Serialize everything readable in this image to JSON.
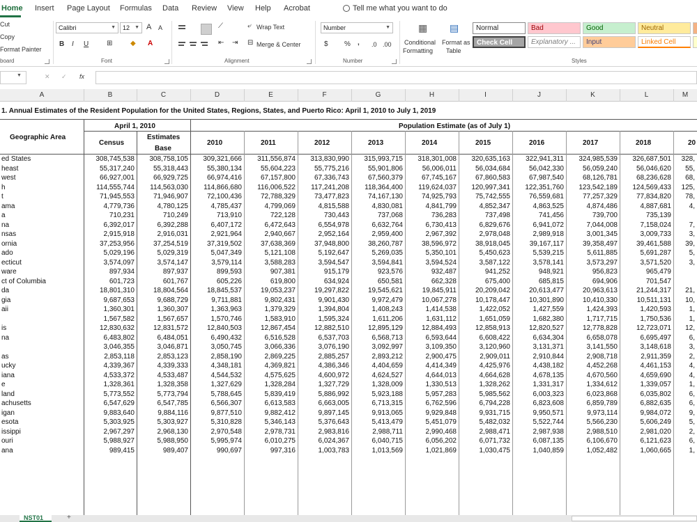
{
  "ribbon_tabs": [
    "Home",
    "Insert",
    "Page Layout",
    "Formulas",
    "Data",
    "Review",
    "View",
    "Help",
    "Acrobat"
  ],
  "tell_me": "Tell me what you want to do",
  "clipboard": {
    "cut": "Cut",
    "copy": "Copy",
    "format_painter": "Format Painter",
    "group": "board"
  },
  "font": {
    "name": "Calibri",
    "size": "12",
    "grow": "A",
    "shrink": "A",
    "bold": "B",
    "italic": "I",
    "underline": "U",
    "group": "Font"
  },
  "alignment": {
    "wrap": "Wrap Text",
    "merge": "Merge & Center",
    "group": "Alignment"
  },
  "number": {
    "format": "Number",
    "currency": "$",
    "percent": "%",
    "comma": ",",
    "inc": ".0",
    "dec": ".00",
    "group": "Number"
  },
  "styles": {
    "conditional": "Conditional",
    "conditional2": "Formatting",
    "format_as": "Format as",
    "format_as2": "Table",
    "cells": [
      "Normal",
      "Bad",
      "Good",
      "Neutral",
      "Check Cell",
      "Explanatory ...",
      "Input",
      "Linked Cell"
    ],
    "group": "Styles"
  },
  "formula_bar": {
    "cancel": "✕",
    "enter": "✓",
    "fx": "fx"
  },
  "columns": [
    "A",
    "B",
    "C",
    "D",
    "E",
    "F",
    "G",
    "H",
    "I",
    "J",
    "K",
    "L",
    "M"
  ],
  "title": "1. Annual Estimates of the Resident Population for the United States, Regions, States, and Puerto Rico: April 1, 2010 to July 1, 2019",
  "header": {
    "geo": "Geographic Area",
    "april": "April 1, 2010",
    "estimate": "Population Estimate (as of July 1)",
    "census": "Census",
    "base1": "Estimates",
    "base2": "Base",
    "years": [
      "2010",
      "2011",
      "2012",
      "2013",
      "2014",
      "2015",
      "2016",
      "2017",
      "2018",
      "20"
    ]
  },
  "rows": [
    {
      "name": "ed States",
      "v": [
        "308,745,538",
        "308,758,105",
        "309,321,666",
        "311,556,874",
        "313,830,990",
        "315,993,715",
        "318,301,008",
        "320,635,163",
        "322,941,311",
        "324,985,539",
        "326,687,501",
        "328,"
      ]
    },
    {
      "name": "heast",
      "v": [
        "55,317,240",
        "55,318,443",
        "55,380,134",
        "55,604,223",
        "55,775,216",
        "55,901,806",
        "56,006,011",
        "56,034,684",
        "56,042,330",
        "56,059,240",
        "56,046,620",
        "55,"
      ]
    },
    {
      "name": "west",
      "v": [
        "66,927,001",
        "66,929,725",
        "66,974,416",
        "67,157,800",
        "67,336,743",
        "67,560,379",
        "67,745,167",
        "67,860,583",
        "67,987,540",
        "68,126,781",
        "68,236,628",
        "68,"
      ]
    },
    {
      "name": "h",
      "v": [
        "114,555,744",
        "114,563,030",
        "114,866,680",
        "116,006,522",
        "117,241,208",
        "118,364,400",
        "119,624,037",
        "120,997,341",
        "122,351,760",
        "123,542,189",
        "124,569,433",
        "125,"
      ]
    },
    {
      "name": "t",
      "v": [
        "71,945,553",
        "71,946,907",
        "72,100,436",
        "72,788,329",
        "73,477,823",
        "74,167,130",
        "74,925,793",
        "75,742,555",
        "76,559,681",
        "77,257,329",
        "77,834,820",
        "78,"
      ]
    },
    {
      "name": "ama",
      "v": [
        "4,779,736",
        "4,780,125",
        "4,785,437",
        "4,799,069",
        "4,815,588",
        "4,830,081",
        "4,841,799",
        "4,852,347",
        "4,863,525",
        "4,874,486",
        "4,887,681",
        "4,"
      ]
    },
    {
      "name": "a",
      "v": [
        "710,231",
        "710,249",
        "713,910",
        "722,128",
        "730,443",
        "737,068",
        "736,283",
        "737,498",
        "741,456",
        "739,700",
        "735,139",
        ""
      ]
    },
    {
      "name": "na",
      "v": [
        "6,392,017",
        "6,392,288",
        "6,407,172",
        "6,472,643",
        "6,554,978",
        "6,632,764",
        "6,730,413",
        "6,829,676",
        "6,941,072",
        "7,044,008",
        "7,158,024",
        "7,"
      ]
    },
    {
      "name": "nsas",
      "v": [
        "2,915,918",
        "2,916,031",
        "2,921,964",
        "2,940,667",
        "2,952,164",
        "2,959,400",
        "2,967,392",
        "2,978,048",
        "2,989,918",
        "3,001,345",
        "3,009,733",
        "3,"
      ]
    },
    {
      "name": "ornia",
      "v": [
        "37,253,956",
        "37,254,519",
        "37,319,502",
        "37,638,369",
        "37,948,800",
        "38,260,787",
        "38,596,972",
        "38,918,045",
        "39,167,117",
        "39,358,497",
        "39,461,588",
        "39,"
      ]
    },
    {
      "name": "ado",
      "v": [
        "5,029,196",
        "5,029,319",
        "5,047,349",
        "5,121,108",
        "5,192,647",
        "5,269,035",
        "5,350,101",
        "5,450,623",
        "5,539,215",
        "5,611,885",
        "5,691,287",
        "5,"
      ]
    },
    {
      "name": "ecticut",
      "v": [
        "3,574,097",
        "3,574,147",
        "3,579,114",
        "3,588,283",
        "3,594,547",
        "3,594,841",
        "3,594,524",
        "3,587,122",
        "3,578,141",
        "3,573,297",
        "3,571,520",
        "3,"
      ]
    },
    {
      "name": "ware",
      "v": [
        "897,934",
        "897,937",
        "899,593",
        "907,381",
        "915,179",
        "923,576",
        "932,487",
        "941,252",
        "948,921",
        "956,823",
        "965,479",
        ""
      ]
    },
    {
      "name": "ct of Columbia",
      "v": [
        "601,723",
        "601,767",
        "605,226",
        "619,800",
        "634,924",
        "650,581",
        "662,328",
        "675,400",
        "685,815",
        "694,906",
        "701,547",
        ""
      ]
    },
    {
      "name": "da",
      "v": [
        "18,801,310",
        "18,804,564",
        "18,845,537",
        "19,053,237",
        "19,297,822",
        "19,545,621",
        "19,845,911",
        "20,209,042",
        "20,613,477",
        "20,963,613",
        "21,244,317",
        "21,"
      ]
    },
    {
      "name": "gia",
      "v": [
        "9,687,653",
        "9,688,729",
        "9,711,881",
        "9,802,431",
        "9,901,430",
        "9,972,479",
        "10,067,278",
        "10,178,447",
        "10,301,890",
        "10,410,330",
        "10,511,131",
        "10,"
      ]
    },
    {
      "name": "aii",
      "v": [
        "1,360,301",
        "1,360,307",
        "1,363,963",
        "1,379,329",
        "1,394,804",
        "1,408,243",
        "1,414,538",
        "1,422,052",
        "1,427,559",
        "1,424,393",
        "1,420,593",
        "1,"
      ]
    },
    {
      "name": "",
      "v": [
        "1,567,582",
        "1,567,657",
        "1,570,746",
        "1,583,910",
        "1,595,324",
        "1,611,206",
        "1,631,112",
        "1,651,059",
        "1,682,380",
        "1,717,715",
        "1,750,536",
        "1,"
      ]
    },
    {
      "name": "is",
      "v": [
        "12,830,632",
        "12,831,572",
        "12,840,503",
        "12,867,454",
        "12,882,510",
        "12,895,129",
        "12,884,493",
        "12,858,913",
        "12,820,527",
        "12,778,828",
        "12,723,071",
        "12,"
      ]
    },
    {
      "name": "na",
      "v": [
        "6,483,802",
        "6,484,051",
        "6,490,432",
        "6,516,528",
        "6,537,703",
        "6,568,713",
        "6,593,644",
        "6,608,422",
        "6,634,304",
        "6,658,078",
        "6,695,497",
        "6,"
      ]
    },
    {
      "name": "",
      "v": [
        "3,046,355",
        "3,046,871",
        "3,050,745",
        "3,066,336",
        "3,076,190",
        "3,092,997",
        "3,109,350",
        "3,120,960",
        "3,131,371",
        "3,141,550",
        "3,148,618",
        "3,"
      ]
    },
    {
      "name": "as",
      "v": [
        "2,853,118",
        "2,853,123",
        "2,858,190",
        "2,869,225",
        "2,885,257",
        "2,893,212",
        "2,900,475",
        "2,909,011",
        "2,910,844",
        "2,908,718",
        "2,911,359",
        "2,"
      ]
    },
    {
      "name": "ucky",
      "v": [
        "4,339,367",
        "4,339,333",
        "4,348,181",
        "4,369,821",
        "4,386,346",
        "4,404,659",
        "4,414,349",
        "4,425,976",
        "4,438,182",
        "4,452,268",
        "4,461,153",
        "4,"
      ]
    },
    {
      "name": "iana",
      "v": [
        "4,533,372",
        "4,533,487",
        "4,544,532",
        "4,575,625",
        "4,600,972",
        "4,624,527",
        "4,644,013",
        "4,664,628",
        "4,678,135",
        "4,670,560",
        "4,659,690",
        "4,"
      ]
    },
    {
      "name": "e",
      "v": [
        "1,328,361",
        "1,328,358",
        "1,327,629",
        "1,328,284",
        "1,327,729",
        "1,328,009",
        "1,330,513",
        "1,328,262",
        "1,331,317",
        "1,334,612",
        "1,339,057",
        "1,"
      ]
    },
    {
      "name": "land",
      "v": [
        "5,773,552",
        "5,773,794",
        "5,788,645",
        "5,839,419",
        "5,886,992",
        "5,923,188",
        "5,957,283",
        "5,985,562",
        "6,003,323",
        "6,023,868",
        "6,035,802",
        "6,"
      ]
    },
    {
      "name": "achusetts",
      "v": [
        "6,547,629",
        "6,547,785",
        "6,566,307",
        "6,613,583",
        "6,663,005",
        "6,713,315",
        "6,762,596",
        "6,794,228",
        "6,823,608",
        "6,859,789",
        "6,882,635",
        "6,"
      ]
    },
    {
      "name": "igan",
      "v": [
        "9,883,640",
        "9,884,116",
        "9,877,510",
        "9,882,412",
        "9,897,145",
        "9,913,065",
        "9,929,848",
        "9,931,715",
        "9,950,571",
        "9,973,114",
        "9,984,072",
        "9,"
      ]
    },
    {
      "name": "esota",
      "v": [
        "5,303,925",
        "5,303,927",
        "5,310,828",
        "5,346,143",
        "5,376,643",
        "5,413,479",
        "5,451,079",
        "5,482,032",
        "5,522,744",
        "5,566,230",
        "5,606,249",
        "5,"
      ]
    },
    {
      "name": "issippi",
      "v": [
        "2,967,297",
        "2,968,130",
        "2,970,548",
        "2,978,731",
        "2,983,816",
        "2,988,711",
        "2,990,468",
        "2,988,471",
        "2,987,938",
        "2,988,510",
        "2,981,020",
        "2,"
      ]
    },
    {
      "name": "ouri",
      "v": [
        "5,988,927",
        "5,988,950",
        "5,995,974",
        "6,010,275",
        "6,024,367",
        "6,040,715",
        "6,056,202",
        "6,071,732",
        "6,087,135",
        "6,106,670",
        "6,121,623",
        "6,"
      ]
    },
    {
      "name": "ana",
      "v": [
        "989,415",
        "989,407",
        "990,697",
        "997,316",
        "1,003,783",
        "1,013,569",
        "1,021,869",
        "1,030,475",
        "1,040,859",
        "1,052,482",
        "1,060,665",
        "1,"
      ]
    }
  ],
  "sheet_tab": "NST01",
  "add_sheet": "+"
}
